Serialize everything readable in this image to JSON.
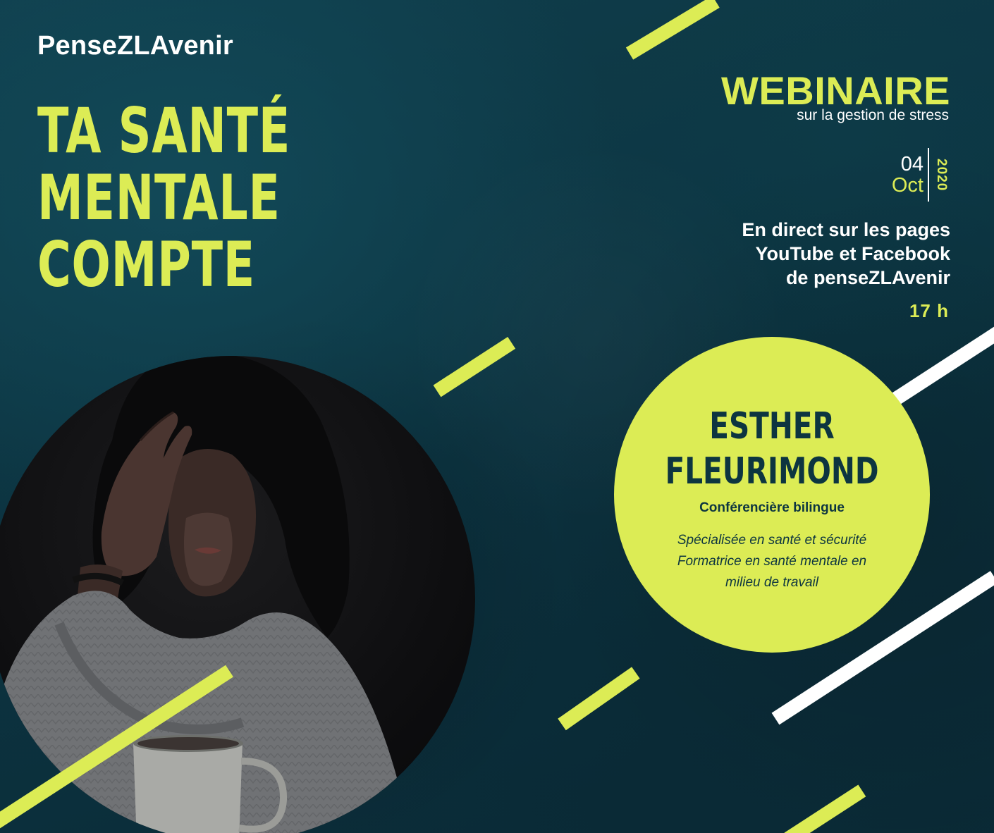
{
  "brand": "PenseZLAvenir",
  "headline": [
    "TA SANTÉ",
    "MENTALE",
    "COMPTE"
  ],
  "event": {
    "type": "WEBINAIRE",
    "topic": "sur la gestion de stress",
    "day": "04",
    "month": "Oct",
    "year": "2020",
    "live_lines": [
      "En direct sur les pages",
      "YouTube et Facebook",
      "de penseZLAvenir"
    ],
    "time": "17 h"
  },
  "speaker": {
    "name_line1": "ESTHER",
    "name_line2": "FLEURIMOND",
    "role": "Conférencière bilingue",
    "desc_lines": [
      "Spécialisée en santé et sécurité",
      "Formatrice en santé mentale en",
      "milieu de travail"
    ]
  },
  "colors": {
    "background": "#0c3441",
    "accent_lime": "#dcec55",
    "text_dark": "#0d3540",
    "white": "#ffffff"
  }
}
